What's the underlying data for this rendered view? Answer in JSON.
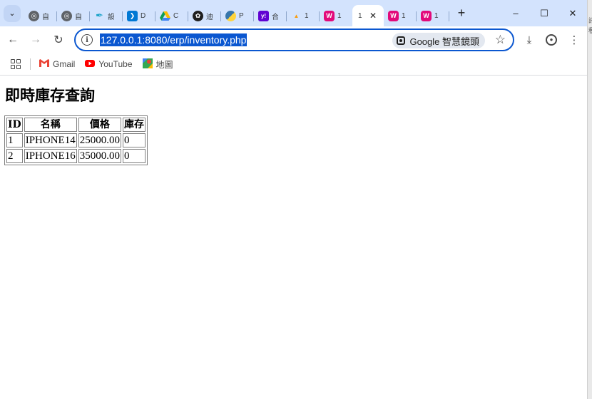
{
  "browser": {
    "tabs": [
      {
        "icon": "globe-icon",
        "title": "自"
      },
      {
        "icon": "globe-icon",
        "title": "自"
      },
      {
        "icon": "pen-tool-icon",
        "title": "設"
      },
      {
        "icon": "vscode-icon",
        "title": "D"
      },
      {
        "icon": "google-drive-icon",
        "title": "C"
      },
      {
        "icon": "openai-icon",
        "title": "迪"
      },
      {
        "icon": "python-icon",
        "title": "P"
      },
      {
        "icon": "yahoo-icon",
        "title": "合"
      },
      {
        "icon": "phpmyadmin-icon",
        "title": "1"
      },
      {
        "icon": "wamp-icon",
        "title": "1"
      },
      {
        "icon": "none",
        "title": "1",
        "active": true
      },
      {
        "icon": "wamp-icon",
        "title": "1"
      },
      {
        "icon": "wamp-icon",
        "title": "1"
      }
    ],
    "url": "127.0.0.1:8080/erp/inventory.php",
    "lens_label": "Google 智慧鏡頭",
    "bookmarks": [
      {
        "icon": "gmail-icon",
        "label": "Gmail"
      },
      {
        "icon": "youtube-icon",
        "label": "YouTube"
      },
      {
        "icon": "maps-icon",
        "label": "地圖"
      }
    ],
    "colors": {
      "tabstrip": "#d3e3fd",
      "accent": "#0b57d0"
    },
    "side_strip_text": [
      "訊",
      "種"
    ]
  },
  "page": {
    "title": "即時庫存查詢",
    "table": {
      "headers": [
        "ID",
        "名稱",
        "價格",
        "庫存"
      ],
      "rows": [
        [
          "1",
          "IPHONE14",
          "25000.00",
          "0"
        ],
        [
          "2",
          "IPHONE16",
          "35000.00",
          "0"
        ]
      ]
    }
  }
}
